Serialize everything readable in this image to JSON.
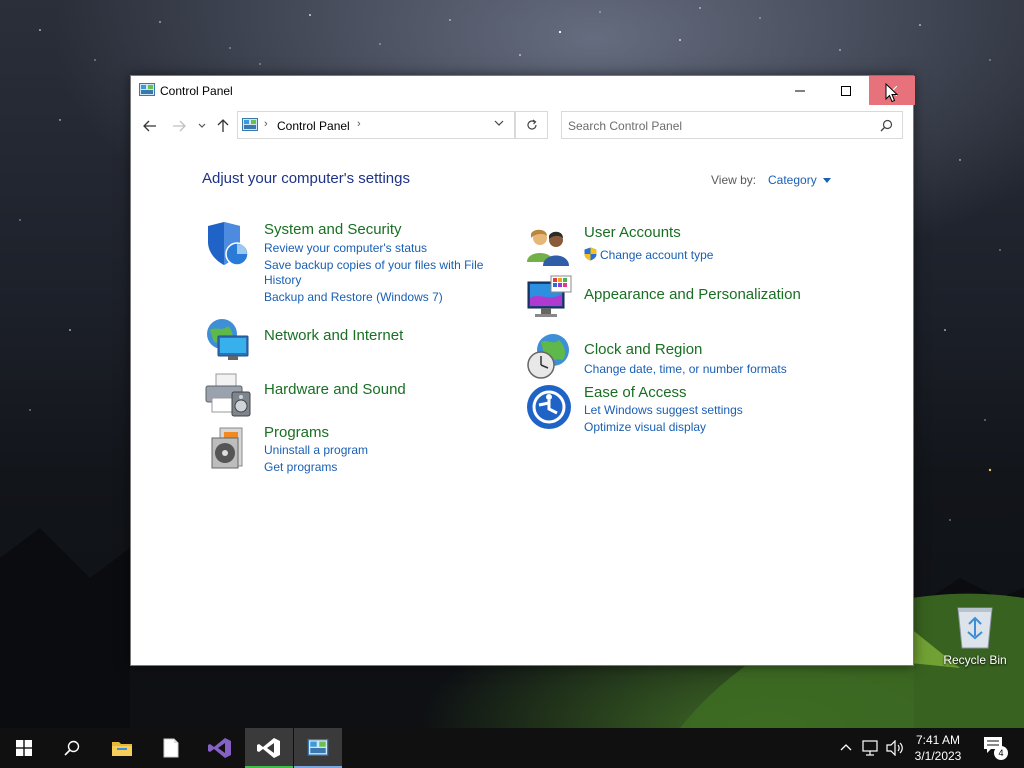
{
  "window": {
    "title": "Control Panel",
    "address": {
      "crumb": "Control Panel"
    },
    "search": {
      "placeholder": "Search Control Panel"
    },
    "heading": "Adjust your computer's settings",
    "view_by": {
      "label": "View by:",
      "value": "Category"
    }
  },
  "categories_left": [
    {
      "title": "System and Security",
      "links": [
        "Review your computer's status",
        "Save backup copies of your files with File",
        "History",
        "Backup and Restore (Windows 7)"
      ]
    },
    {
      "title": "Network and Internet",
      "links": []
    },
    {
      "title": "Hardware and Sound",
      "links": []
    },
    {
      "title": "Programs",
      "links": [
        "Uninstall a program",
        "Get programs"
      ]
    }
  ],
  "categories_right": [
    {
      "title": "User Accounts",
      "links": [
        "Change account type"
      ]
    },
    {
      "title": "Appearance and Personalization",
      "links": []
    },
    {
      "title": "Clock and Region",
      "links": [
        "Change date, time, or number formats"
      ]
    },
    {
      "title": "Ease of Access",
      "links": [
        "Let Windows suggest settings",
        "Optimize visual display"
      ]
    }
  ],
  "desktop": {
    "recycle_bin": "Recycle Bin"
  },
  "taskbar": {
    "time": "7:41 AM",
    "date": "3/1/2023",
    "notification_count": "4"
  },
  "colors": {
    "heading": "#1e3287",
    "category_title": "#196f23",
    "link": "#1a5fb4",
    "close_hover": "#e8727b"
  }
}
